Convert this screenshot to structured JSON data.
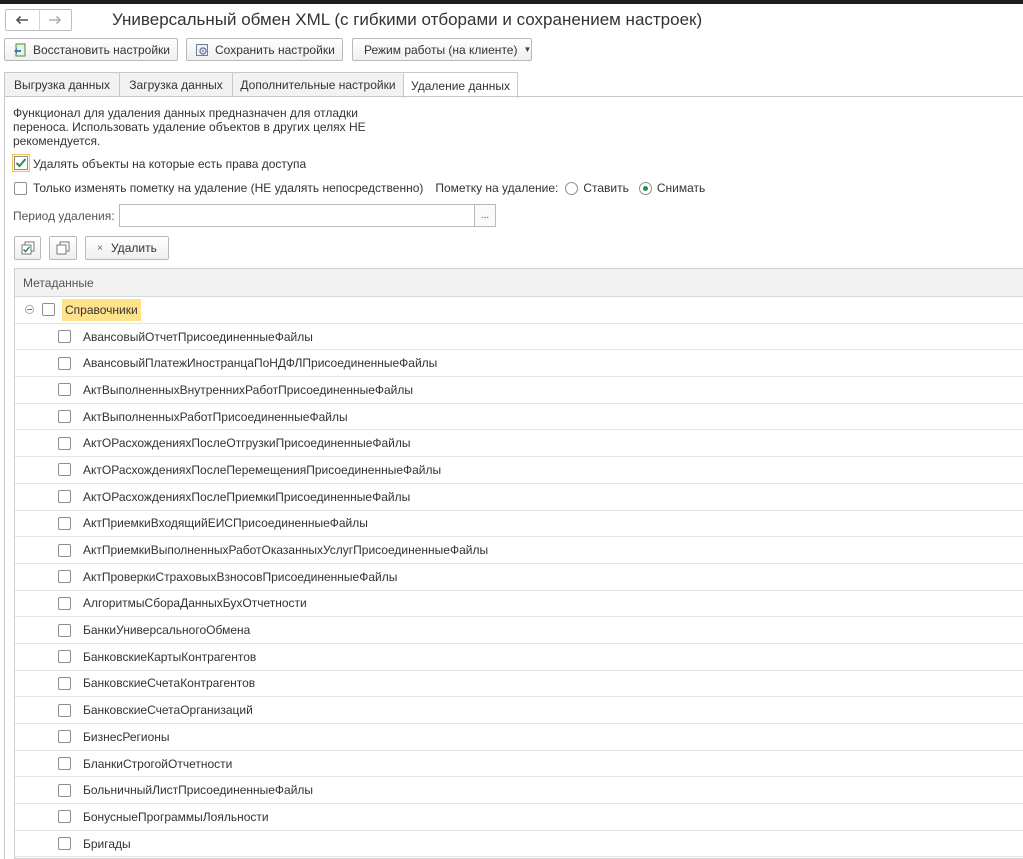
{
  "window": {
    "title": "Универсальный обмен XML (с гибкими отборами и сохранением настроек)"
  },
  "toolbar": {
    "restore_label": "Восстановить настройки",
    "save_label": "Сохранить настройки",
    "mode_label": "Режим работы (на клиенте)"
  },
  "tabs": [
    {
      "label": "Выгрузка данных"
    },
    {
      "label": "Загрузка данных"
    },
    {
      "label": "Дополнительные настройки"
    },
    {
      "label": "Удаление данных"
    }
  ],
  "active_tab": "Удаление данных",
  "delete_panel": {
    "description": "Функционал для удаления данных предназначен для отладки переноса. Использовать удаление объектов в других целях НЕ рекомендуется.",
    "delete_accessible_label": "Удалять объекты на которые есть права доступа",
    "delete_accessible_checked": true,
    "only_mark_label": "Только изменять пометку на удаление (НЕ удалять непосредственно)",
    "only_mark_checked": false,
    "mark_label": "Пометку на удаление:",
    "mark_options": [
      "Ставить",
      "Снимать"
    ],
    "mark_selected": "Снимать",
    "period_label": "Период удаления:",
    "period_value": "",
    "period_button": "...",
    "delete_button": "Удалить"
  },
  "table": {
    "header": "Метаданные",
    "root": {
      "label": "Справочники",
      "checked": false,
      "expanded": true
    },
    "items": [
      "АвансовыйОтчетПрисоединенныеФайлы",
      "АвансовыйПлатежИностранцаПоНДФЛПрисоединенныеФайлы",
      "АктВыполненныхВнутреннихРаботПрисоединенныеФайлы",
      "АктВыполненныхРаботПрисоединенныеФайлы",
      "АктОРасхожденияхПослеОтгрузкиПрисоединенныеФайлы",
      "АктОРасхожденияхПослеПеремещенияПрисоединенныеФайлы",
      "АктОРасхожденияхПослеПриемкиПрисоединенныеФайлы",
      "АктПриемкиВходящийЕИСПрисоединенныеФайлы",
      "АктПриемкиВыполненныхРаботОказанныхУслугПрисоединенныеФайлы",
      "АктПроверкиСтраховыхВзносовПрисоединенныеФайлы",
      "АлгоритмыСбораДанныхБухОтчетности",
      "БанкиУниверсальногоОбмена",
      "БанковскиеКартыКонтрагентов",
      "БанковскиеСчетаКонтрагентов",
      "БанковскиеСчетаОрганизаций",
      "БизнесРегионы",
      "БланкиСтрогойОтчетности",
      "БольничныйЛистПрисоединенныеФайлы",
      "БонусныеПрограммыЛояльности",
      "Бригады"
    ]
  },
  "colors": {
    "highlight": "#ffe38a",
    "radio_selected": "#2d8a4f",
    "checkbox_tick": "#2d8a4f"
  }
}
